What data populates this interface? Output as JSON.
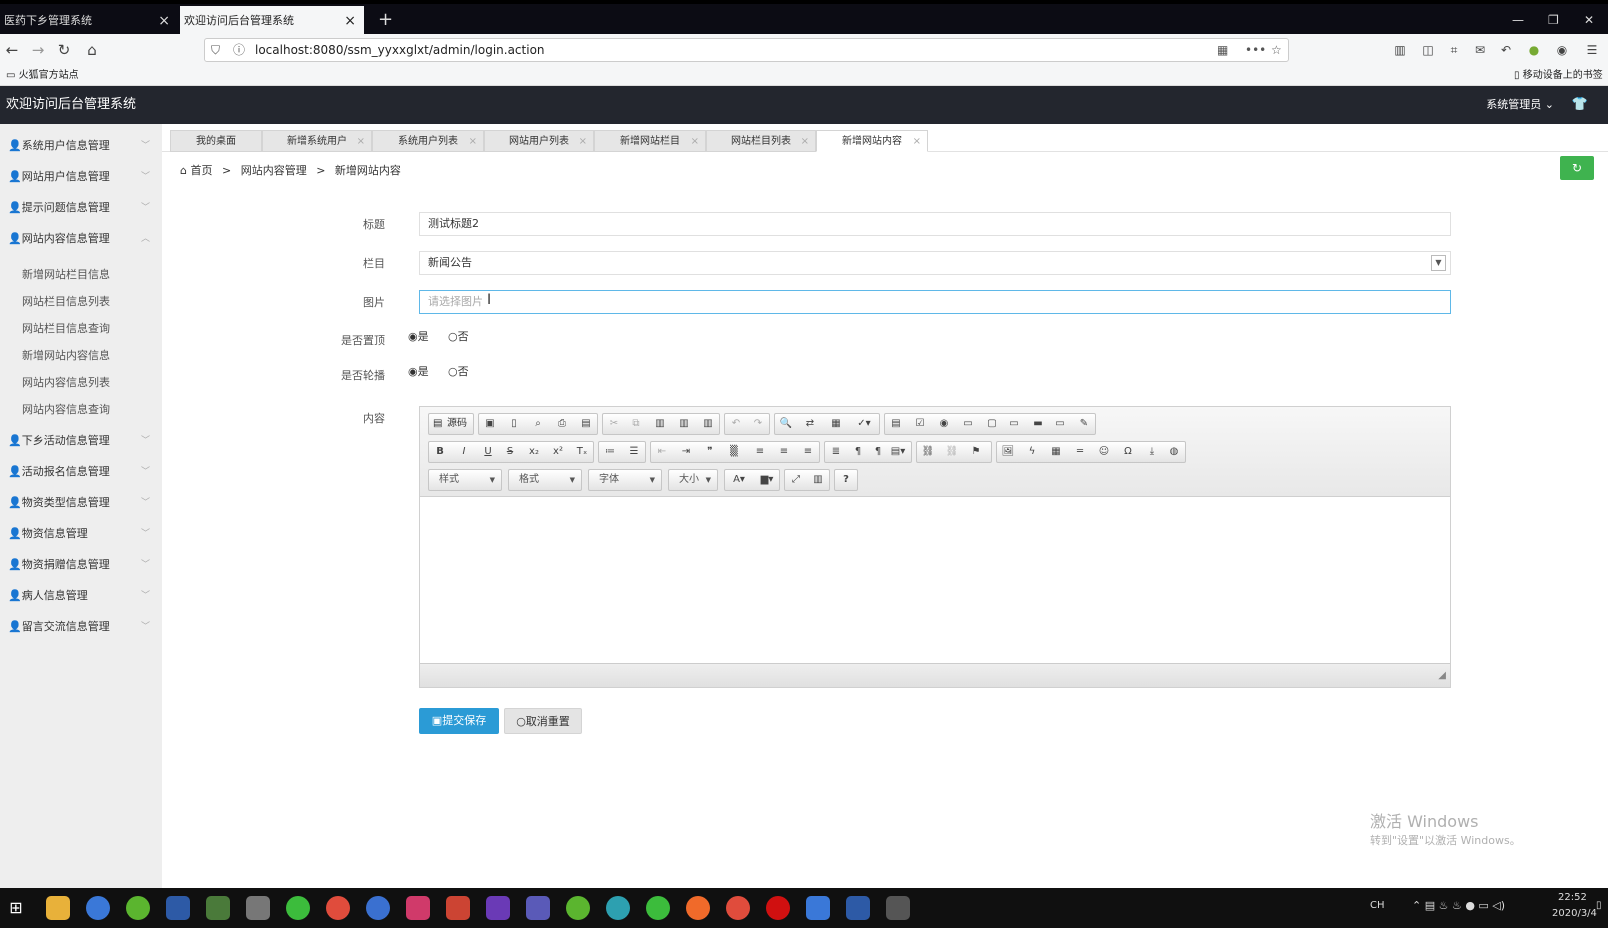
{
  "browser": {
    "tabs": [
      {
        "label": "医药下乡管理系统"
      },
      {
        "label": "欢迎访问后台管理系统"
      }
    ],
    "new_tab": "+",
    "url": "localhost:8080/ssm_yyxxglxt/admin/login.action",
    "bookmark": "火狐官方站点",
    "mobile_bookmarks": "移动设备上的书签"
  },
  "app": {
    "title": "欢迎访问后台管理系统",
    "user": "系统管理员"
  },
  "sidebar": {
    "items": [
      {
        "label": "系统用户信息管理"
      },
      {
        "label": "网站用户信息管理"
      },
      {
        "label": "提示问题信息管理"
      },
      {
        "label": "网站内容信息管理"
      },
      {
        "label": "下乡活动信息管理"
      },
      {
        "label": "活动报名信息管理"
      },
      {
        "label": "物资类型信息管理"
      },
      {
        "label": "物资信息管理"
      },
      {
        "label": "物资捐赠信息管理"
      },
      {
        "label": "病人信息管理"
      },
      {
        "label": "留言交流信息管理"
      }
    ],
    "subitems": [
      {
        "label": "新增网站栏目信息"
      },
      {
        "label": "网站栏目信息列表"
      },
      {
        "label": "网站栏目信息查询"
      },
      {
        "label": "新增网站内容信息"
      },
      {
        "label": "网站内容信息列表"
      },
      {
        "label": "网站内容信息查询"
      }
    ]
  },
  "page_tabs": [
    {
      "label": "我的桌面"
    },
    {
      "label": "新增系统用户"
    },
    {
      "label": "系统用户列表"
    },
    {
      "label": "网站用户列表"
    },
    {
      "label": "新增网站栏目"
    },
    {
      "label": "网站栏目列表"
    },
    {
      "label": "新增网站内容"
    }
  ],
  "breadcrumb": {
    "home": "首页",
    "section": "网站内容管理",
    "current": "新增网站内容",
    "sep": ">"
  },
  "form": {
    "title_label": "标题",
    "title_value": "测试标题2",
    "column_label": "栏目",
    "column_value": "新闻公告",
    "image_label": "图片",
    "image_placeholder": "请选择图片",
    "top_label": "是否置顶",
    "carousel_label": "是否轮播",
    "yes": "是",
    "no": "否",
    "content_label": "内容",
    "source_label": "源码",
    "style_dropdown": "样式",
    "format_dropdown": "格式",
    "font_dropdown": "字体",
    "size_dropdown": "大小",
    "save_button": "提交保存",
    "reset_button": "取消重置"
  },
  "watermark": {
    "line1": "激活 Windows",
    "line2": "转到\"设置\"以激活 Windows。"
  },
  "taskbar": {
    "time": "22:52",
    "date": "2020/3/4",
    "ime": "CH"
  }
}
